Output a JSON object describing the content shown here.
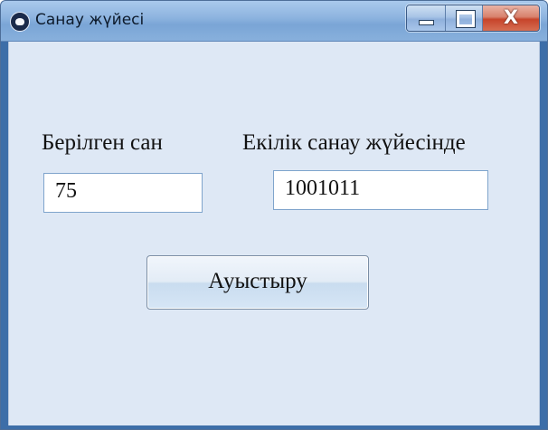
{
  "window": {
    "title": "Санау жүйесі",
    "icon": "app-icon"
  },
  "caption_buttons": {
    "minimize_icon": "minimize-icon",
    "maximize_icon": "maximize-icon",
    "close_label": "X"
  },
  "form": {
    "given_label": "Берілген сан",
    "given_value": "75",
    "binary_label": "Екілік санау жүйесінде",
    "binary_value": "1001011",
    "convert_button": "Ауыстыру"
  },
  "colors": {
    "client_background": "#dee8f5",
    "close_button": "#c7442b",
    "title_bar": "#8fb5e0"
  }
}
